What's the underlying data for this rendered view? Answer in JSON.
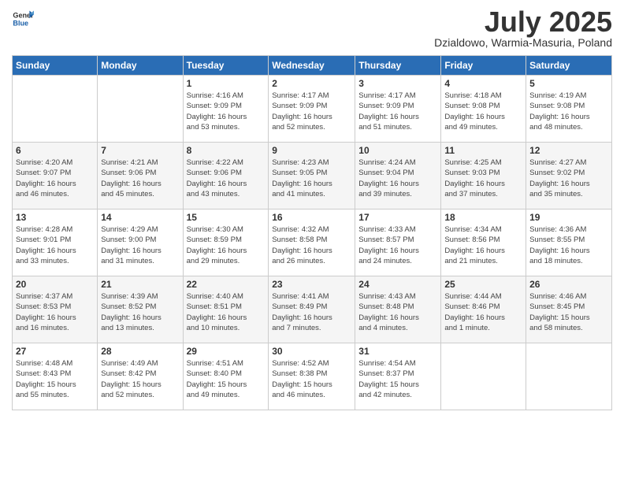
{
  "header": {
    "logo_line1": "General",
    "logo_line2": "Blue",
    "month": "July 2025",
    "location": "Dzialdowo, Warmia-Masuria, Poland"
  },
  "weekdays": [
    "Sunday",
    "Monday",
    "Tuesday",
    "Wednesday",
    "Thursday",
    "Friday",
    "Saturday"
  ],
  "weeks": [
    [
      {
        "day": "",
        "info": ""
      },
      {
        "day": "",
        "info": ""
      },
      {
        "day": "1",
        "info": "Sunrise: 4:16 AM\nSunset: 9:09 PM\nDaylight: 16 hours\nand 53 minutes."
      },
      {
        "day": "2",
        "info": "Sunrise: 4:17 AM\nSunset: 9:09 PM\nDaylight: 16 hours\nand 52 minutes."
      },
      {
        "day": "3",
        "info": "Sunrise: 4:17 AM\nSunset: 9:09 PM\nDaylight: 16 hours\nand 51 minutes."
      },
      {
        "day": "4",
        "info": "Sunrise: 4:18 AM\nSunset: 9:08 PM\nDaylight: 16 hours\nand 49 minutes."
      },
      {
        "day": "5",
        "info": "Sunrise: 4:19 AM\nSunset: 9:08 PM\nDaylight: 16 hours\nand 48 minutes."
      }
    ],
    [
      {
        "day": "6",
        "info": "Sunrise: 4:20 AM\nSunset: 9:07 PM\nDaylight: 16 hours\nand 46 minutes."
      },
      {
        "day": "7",
        "info": "Sunrise: 4:21 AM\nSunset: 9:06 PM\nDaylight: 16 hours\nand 45 minutes."
      },
      {
        "day": "8",
        "info": "Sunrise: 4:22 AM\nSunset: 9:06 PM\nDaylight: 16 hours\nand 43 minutes."
      },
      {
        "day": "9",
        "info": "Sunrise: 4:23 AM\nSunset: 9:05 PM\nDaylight: 16 hours\nand 41 minutes."
      },
      {
        "day": "10",
        "info": "Sunrise: 4:24 AM\nSunset: 9:04 PM\nDaylight: 16 hours\nand 39 minutes."
      },
      {
        "day": "11",
        "info": "Sunrise: 4:25 AM\nSunset: 9:03 PM\nDaylight: 16 hours\nand 37 minutes."
      },
      {
        "day": "12",
        "info": "Sunrise: 4:27 AM\nSunset: 9:02 PM\nDaylight: 16 hours\nand 35 minutes."
      }
    ],
    [
      {
        "day": "13",
        "info": "Sunrise: 4:28 AM\nSunset: 9:01 PM\nDaylight: 16 hours\nand 33 minutes."
      },
      {
        "day": "14",
        "info": "Sunrise: 4:29 AM\nSunset: 9:00 PM\nDaylight: 16 hours\nand 31 minutes."
      },
      {
        "day": "15",
        "info": "Sunrise: 4:30 AM\nSunset: 8:59 PM\nDaylight: 16 hours\nand 29 minutes."
      },
      {
        "day": "16",
        "info": "Sunrise: 4:32 AM\nSunset: 8:58 PM\nDaylight: 16 hours\nand 26 minutes."
      },
      {
        "day": "17",
        "info": "Sunrise: 4:33 AM\nSunset: 8:57 PM\nDaylight: 16 hours\nand 24 minutes."
      },
      {
        "day": "18",
        "info": "Sunrise: 4:34 AM\nSunset: 8:56 PM\nDaylight: 16 hours\nand 21 minutes."
      },
      {
        "day": "19",
        "info": "Sunrise: 4:36 AM\nSunset: 8:55 PM\nDaylight: 16 hours\nand 18 minutes."
      }
    ],
    [
      {
        "day": "20",
        "info": "Sunrise: 4:37 AM\nSunset: 8:53 PM\nDaylight: 16 hours\nand 16 minutes."
      },
      {
        "day": "21",
        "info": "Sunrise: 4:39 AM\nSunset: 8:52 PM\nDaylight: 16 hours\nand 13 minutes."
      },
      {
        "day": "22",
        "info": "Sunrise: 4:40 AM\nSunset: 8:51 PM\nDaylight: 16 hours\nand 10 minutes."
      },
      {
        "day": "23",
        "info": "Sunrise: 4:41 AM\nSunset: 8:49 PM\nDaylight: 16 hours\nand 7 minutes."
      },
      {
        "day": "24",
        "info": "Sunrise: 4:43 AM\nSunset: 8:48 PM\nDaylight: 16 hours\nand 4 minutes."
      },
      {
        "day": "25",
        "info": "Sunrise: 4:44 AM\nSunset: 8:46 PM\nDaylight: 16 hours\nand 1 minute."
      },
      {
        "day": "26",
        "info": "Sunrise: 4:46 AM\nSunset: 8:45 PM\nDaylight: 15 hours\nand 58 minutes."
      }
    ],
    [
      {
        "day": "27",
        "info": "Sunrise: 4:48 AM\nSunset: 8:43 PM\nDaylight: 15 hours\nand 55 minutes."
      },
      {
        "day": "28",
        "info": "Sunrise: 4:49 AM\nSunset: 8:42 PM\nDaylight: 15 hours\nand 52 minutes."
      },
      {
        "day": "29",
        "info": "Sunrise: 4:51 AM\nSunset: 8:40 PM\nDaylight: 15 hours\nand 49 minutes."
      },
      {
        "day": "30",
        "info": "Sunrise: 4:52 AM\nSunset: 8:38 PM\nDaylight: 15 hours\nand 46 minutes."
      },
      {
        "day": "31",
        "info": "Sunrise: 4:54 AM\nSunset: 8:37 PM\nDaylight: 15 hours\nand 42 minutes."
      },
      {
        "day": "",
        "info": ""
      },
      {
        "day": "",
        "info": ""
      }
    ]
  ]
}
